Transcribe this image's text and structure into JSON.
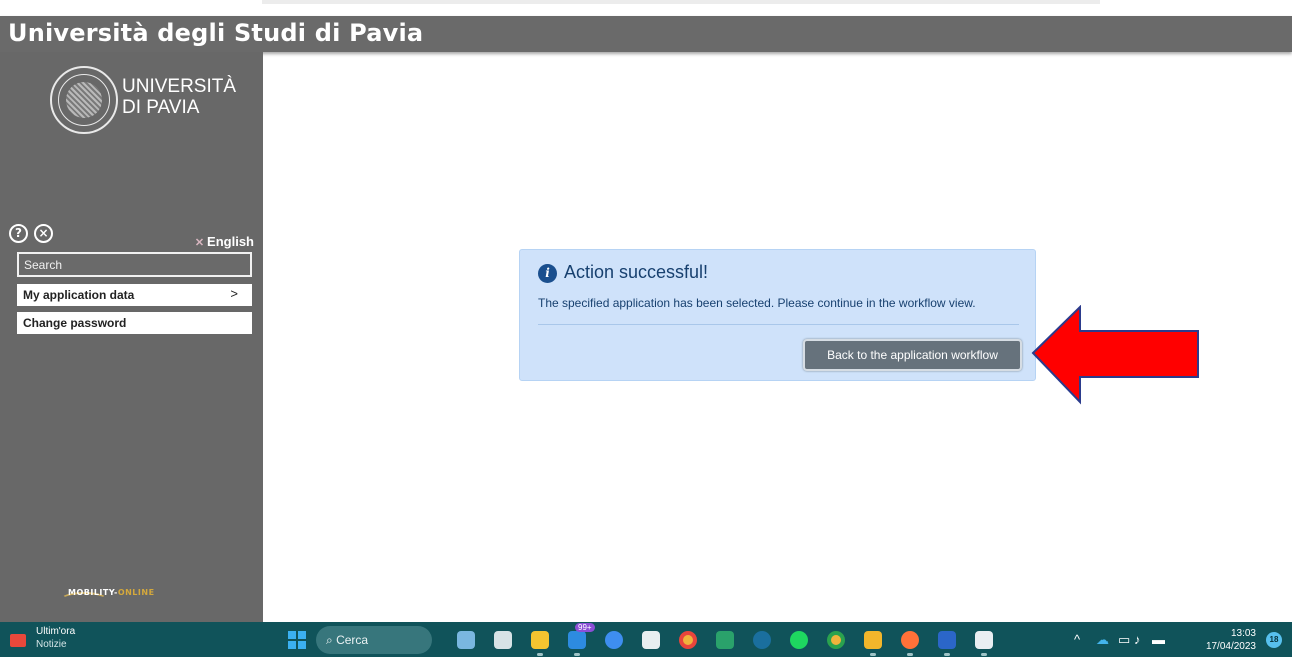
{
  "header": {
    "title": "Università degli Studi di Pavia"
  },
  "sidebar": {
    "logo_line1": "UNIVERSITÀ",
    "logo_line2": "DI PAVIA",
    "help_glyph": "?",
    "close_glyph": "×",
    "language": "English",
    "search_placeholder": "Search",
    "items": [
      {
        "label": "My application data",
        "chevron": ">"
      },
      {
        "label": "Change password"
      }
    ],
    "footer_logo_a": "MOBILITY-",
    "footer_logo_b": "ONLINE"
  },
  "alert": {
    "info_glyph": "i",
    "heading": "Action successful!",
    "message": "The specified application has been selected. Please continue in the workflow view.",
    "button_label": "Back to the application workflow"
  },
  "annotation": {
    "arrow_color": "#ff0000"
  },
  "taskbar": {
    "news_title": "Ultim'ora",
    "news_subtitle": "Notizie",
    "search_label": "Cerca",
    "mail_badge": "99+",
    "app_icons": [
      "photos-icon",
      "taskview-icon",
      "file-explorer-icon",
      "mail-icon",
      "copilot-icon",
      "store-icon",
      "chrome-icon",
      "calendar-icon",
      "pinned-app-icon",
      "spotify-icon",
      "chrome-profile-icon",
      "lock-app-icon",
      "firefox-icon",
      "word-icon",
      "bank-icon"
    ],
    "tray_up": "^",
    "time": "13:03",
    "date": "17/04/2023",
    "notification_count": "18"
  }
}
